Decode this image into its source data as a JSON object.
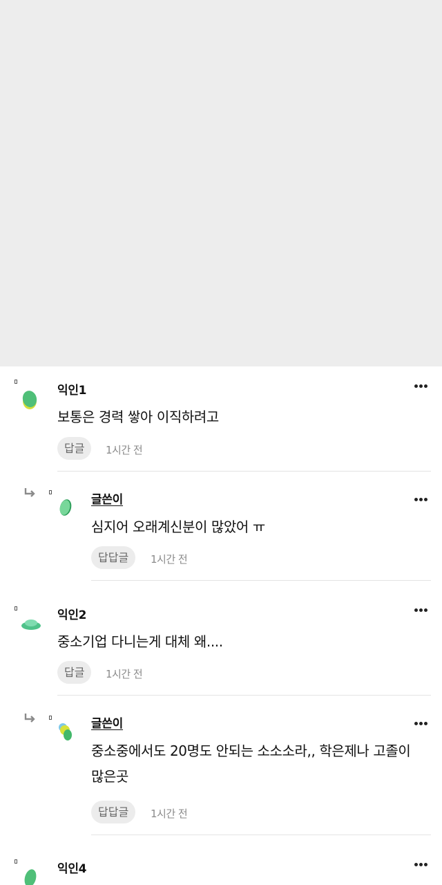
{
  "comments": [
    {
      "author": "익인1",
      "text": "보통은 경력 쌓아 이직하려고",
      "reply_label": "답글",
      "time": "1시간 전",
      "is_reply": false
    },
    {
      "author": "글쓴이",
      "text": "심지어 오래계신분이 많았어 ㅠ",
      "reply_label": "답답글",
      "time": "1시간 전",
      "is_reply": true
    },
    {
      "author": "익인2",
      "text": "중소기업 다니는게 대체 왜....",
      "reply_label": "답글",
      "time": "1시간 전",
      "is_reply": false
    },
    {
      "author": "글쓴이",
      "text": "중소중에서도 20명도 안되는 소소소라,, 학은제나 고졸이 많은곳",
      "reply_label": "답답글",
      "time": "1시간 전",
      "is_reply": true
    },
    {
      "author": "익인4",
      "is_reply": false
    }
  ],
  "icons": {
    "more": "more-horizontal-icon",
    "reply_arrow": "reply-arrow-icon"
  },
  "colors": {
    "avatar_green": "#5fc77f",
    "avatar_yellow": "#d8e23a",
    "placeholder_bg": "#ededed"
  }
}
